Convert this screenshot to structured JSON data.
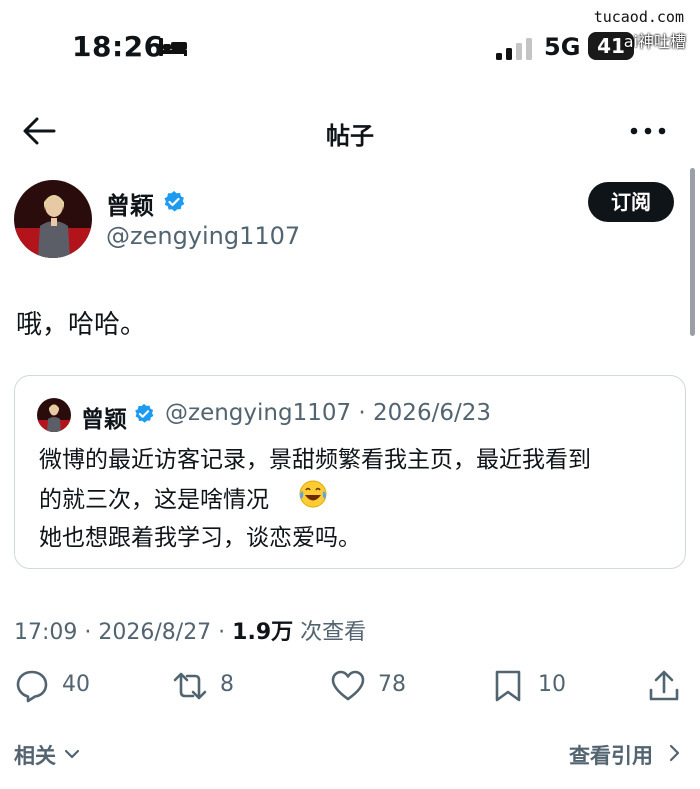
{
  "status_bar": {
    "time": "18:26",
    "network": "5G",
    "battery": "41",
    "watermark_site": "tucaod.com",
    "watermark_label": "ai神吐槽"
  },
  "nav": {
    "title": "帖子"
  },
  "post": {
    "author_name": "曾颖",
    "author_handle": "@zengying1107",
    "subscribe_label": "订阅",
    "text": "哦，哈哈。",
    "meta_prefix": "17:09 · 2026/8/27 · ",
    "views": "1.9万",
    "views_suffix": " 次查看"
  },
  "quote": {
    "author_name": "曾颖",
    "handle_date": "@zengying1107 · 2026/6/23",
    "lines": [
      "微博的最近访客记录，景甜频繁看我主页，最近我看到",
      "的就三次，这是啥情况",
      "她也想跟着我学习，谈恋爱吗。"
    ],
    "emoji": "face-with-tears-of-joy"
  },
  "actions": {
    "replies": "40",
    "reposts": "8",
    "likes": "78",
    "bookmarks": "10"
  },
  "footer": {
    "related_label": "相关",
    "view_quotes_label": "查看引用"
  },
  "colors": {
    "text_primary": "#0f1419",
    "text_secondary": "#536471",
    "verified_blue": "#1d9bf0",
    "border": "#cfd9de"
  }
}
